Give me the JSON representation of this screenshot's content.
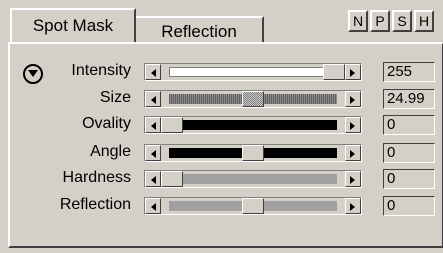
{
  "tabs": [
    {
      "label": "Spot Mask",
      "active": true
    },
    {
      "label": "Reflection",
      "active": false
    }
  ],
  "mini_buttons": [
    {
      "label": "N"
    },
    {
      "label": "P"
    },
    {
      "label": "S"
    },
    {
      "label": "H"
    }
  ],
  "rows": [
    {
      "label": "Intensity",
      "value": "255",
      "level": 1.0,
      "fill": "white"
    },
    {
      "label": "Size",
      "value": "24.99",
      "level": 0.5,
      "fill": "dither"
    },
    {
      "label": "Ovality",
      "value": "0",
      "level": 0.0,
      "fill": "black"
    },
    {
      "label": "Angle",
      "value": "0",
      "level": 0.5,
      "fill": "black"
    },
    {
      "label": "Hardness",
      "value": "0",
      "level": 0.0,
      "fill": "gray"
    },
    {
      "label": "Reflection",
      "value": "0",
      "level": 0.5,
      "fill": "gray"
    }
  ],
  "colors": {
    "panel": "#d4d0c8",
    "track_black": "#000000",
    "track_gray": "#a0a0a0",
    "track_white": "#ffffff"
  },
  "icons": {
    "expand": "chevron-down-circle-icon",
    "left": "arrow-left-icon",
    "right": "arrow-right-icon"
  }
}
